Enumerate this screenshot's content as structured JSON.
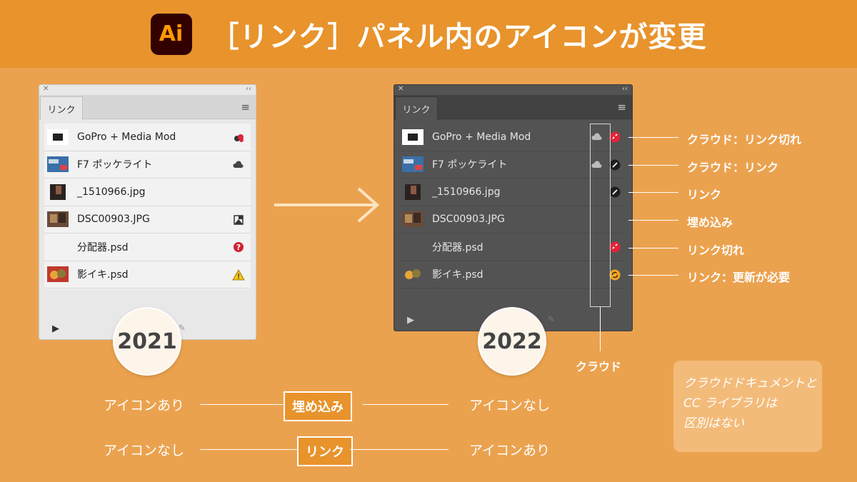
{
  "banner": {
    "logo": "Ai",
    "title": "［リンク］パネル内のアイコンが変更"
  },
  "panel": {
    "tab_label": "リンク",
    "close_glyph": "✕",
    "collapse_glyph": "‹‹",
    "menu_glyph": "≡",
    "footer_glyph": "▶"
  },
  "items": [
    {
      "name": "GoPro + Media Mod"
    },
    {
      "name": "F7 ポッケライト"
    },
    {
      "name": "_1510966.jpg"
    },
    {
      "name": "DSC00903.JPG"
    },
    {
      "name": "分配器.psd"
    },
    {
      "name": "影イキ.psd"
    }
  ],
  "status_2021": [
    "cloud-broken-icon",
    "cloud-icon",
    "",
    "embedded-icon",
    "missing-icon",
    "warning-icon"
  ],
  "status_2022": [
    "broken-link-icon",
    "link-icon",
    "link-icon",
    "",
    "broken-link-icon",
    "update-icon"
  ],
  "cloud_2022": [
    true,
    true,
    false,
    false,
    false,
    false
  ],
  "years": {
    "old": "2021",
    "new": "2022"
  },
  "cloud_label": "クラウド",
  "callouts": [
    "クラウド：リンク切れ",
    "クラウド：リンク",
    "リンク",
    "埋め込み",
    "リンク切れ",
    "リンク：更新が必要"
  ],
  "note": {
    "lines": [
      "クラウドドキュメントと",
      "CC ライブラリは",
      "区別はない"
    ]
  },
  "comparison": [
    {
      "left": "アイコンあり",
      "chip": "埋め込み",
      "right": "アイコンなし"
    },
    {
      "left": "アイコンなし",
      "chip": "リンク",
      "right": "アイコンあり"
    }
  ],
  "colors": {
    "banner": "#e8932c",
    "background": "#eba24f",
    "logo_bg": "#330000",
    "logo_fg": "#ff9a00",
    "broken": "#e0253a",
    "update": "#f5a623"
  }
}
